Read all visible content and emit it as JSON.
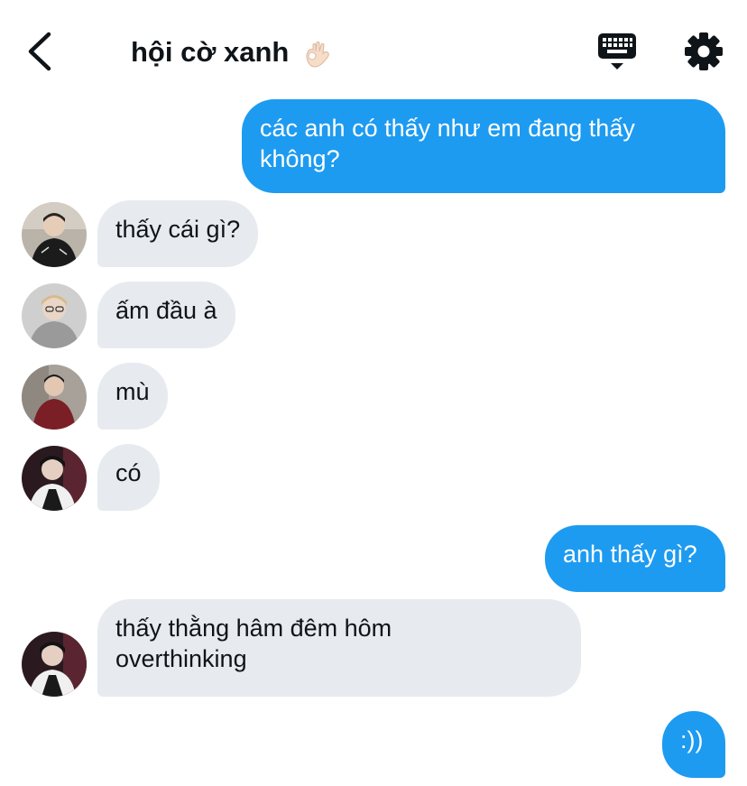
{
  "header": {
    "title": "hội cờ xanh",
    "title_emoji": "👌🏻",
    "back_icon": "chevron-left-icon",
    "keyboard_icon": "keyboard-icon",
    "settings_icon": "gear-icon"
  },
  "colors": {
    "outgoing_bubble": "#1d9bf0",
    "incoming_bubble": "#e7ebef",
    "text": "#0f1419"
  },
  "messages": [
    {
      "direction": "outgoing",
      "text": "các anh có thấy như em đang thấy không?"
    },
    {
      "direction": "incoming",
      "text": "thấy cái gì?"
    },
    {
      "direction": "incoming",
      "text": "ấm đầu à"
    },
    {
      "direction": "incoming",
      "text": "mù"
    },
    {
      "direction": "incoming",
      "text": "có"
    },
    {
      "direction": "outgoing",
      "text": "anh thấy gì?"
    },
    {
      "direction": "incoming",
      "text": "thấy thằng hâm đêm hôm overthinking"
    },
    {
      "direction": "outgoing",
      "text": ":))"
    }
  ]
}
